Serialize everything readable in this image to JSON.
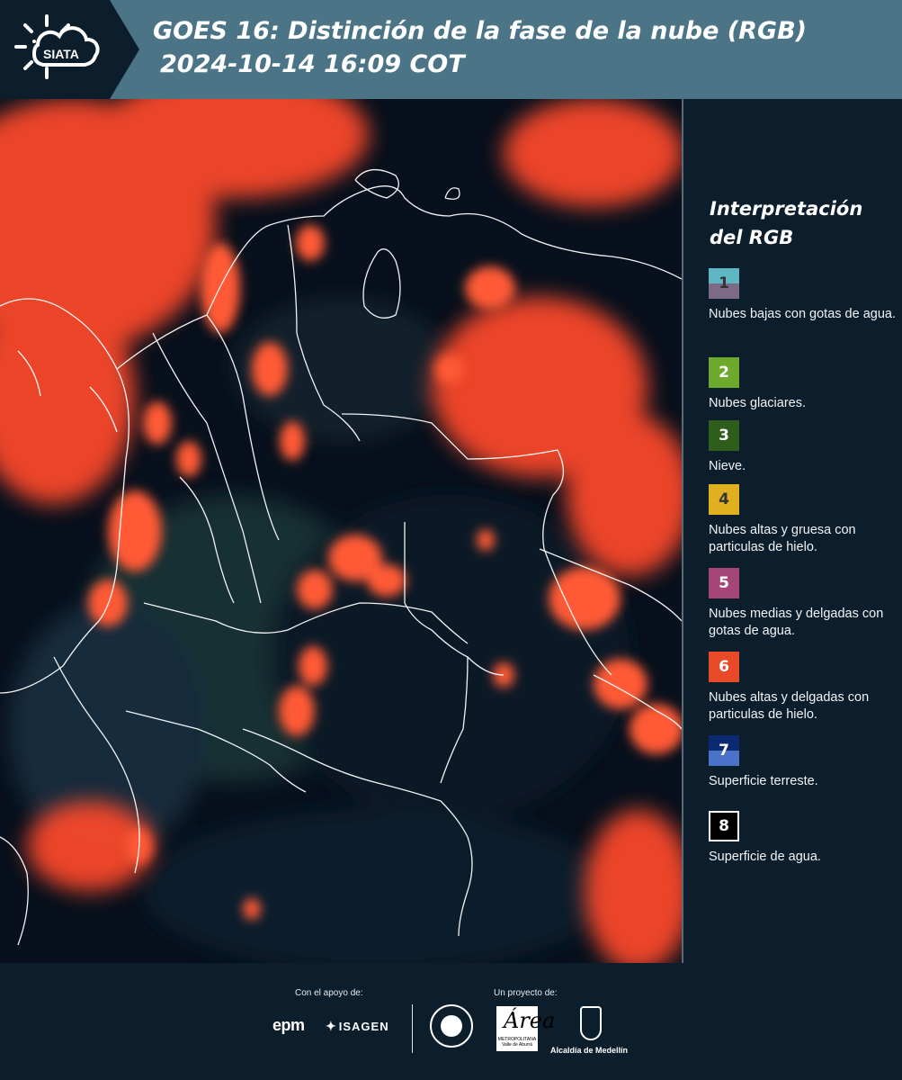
{
  "header": {
    "logo_text": "SIATA",
    "title_line1": "GOES 16: Distinción de la fase de la nube (RGB)",
    "title_line2": "2024-10-14 16:09 COT"
  },
  "legend": {
    "title_line1": "Interpretación",
    "title_line2": "del RGB",
    "items": [
      {
        "number": "1",
        "label": "Nubes bajas con gotas de agua.",
        "color_top": "#5fb7c4",
        "color_bottom": "#7d6a86",
        "text_color": "#333333"
      },
      {
        "number": "2",
        "label": "Nubes glaciares.",
        "color_top": "#6da92d",
        "color_bottom": "#6da92d",
        "text_color": "#ffffff"
      },
      {
        "number": "3",
        "label": "Nieve.",
        "color_top": "#2e5d1c",
        "color_bottom": "#2e5d1c",
        "text_color": "#ffffff"
      },
      {
        "number": "4",
        "label": "Nubes altas y gruesa con particulas de hielo.",
        "color_top": "#e0b020",
        "color_bottom": "#e0b020",
        "text_color": "#333333"
      },
      {
        "number": "5",
        "label": "Nubes medias y delgadas con gotas de agua.",
        "color_top": "#a5457a",
        "color_bottom": "#a5457a",
        "text_color": "#ffffff"
      },
      {
        "number": "6",
        "label": "Nubes altas y delgadas con particulas de hielo.",
        "color_top": "#e84a27",
        "color_bottom": "#e84a27",
        "text_color": "#ffffff"
      },
      {
        "number": "7",
        "label": "Superficie terreste.",
        "color_top": "#0c2a72",
        "color_bottom": "#4a72c8",
        "text_color": "#ffffff"
      },
      {
        "number": "8",
        "label": "Superficie de agua.",
        "color_top": "#000000",
        "color_bottom": "#000000",
        "text_color": "#ffffff"
      }
    ]
  },
  "footer": {
    "support_label": "Con el apoyo de:",
    "project_label": "Un proyecto de:",
    "epm": "epm",
    "isagen": "ISAGEN",
    "area_letter": "Área",
    "area_subtitle": "METROPOLITANA Valle de Aburrá",
    "medellin": "Alcaldía de Medellín"
  },
  "colors": {
    "header_bg": "#4b7587",
    "panel_bg": "#0c1d2b",
    "cloud_red": "#ff4a2a"
  }
}
